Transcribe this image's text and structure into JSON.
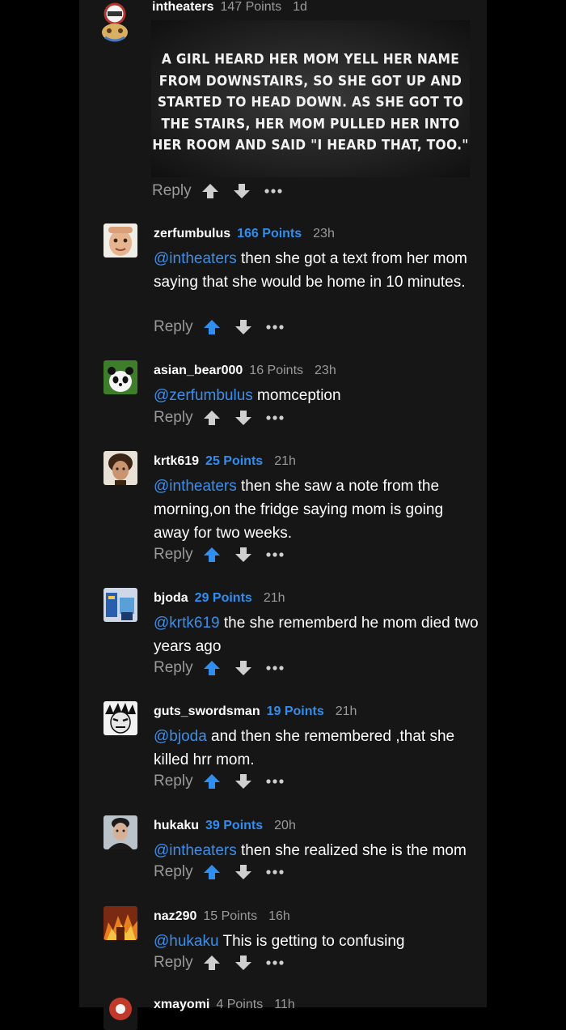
{
  "top_comment": {
    "username": "intheaters",
    "points": "147 Points",
    "time": "1d",
    "meme_text": "A GIRL HEARD HER MOM YELL HER NAME FROM DOWNSTAIRS, SO SHE GOT UP AND STARTED TO HEAD DOWN. AS SHE GOT TO THE STAIRS, HER MOM PULLED HER INTO HER ROOM AND SAID \"I HEARD THAT, TOO.\"",
    "reply_label": "Reply"
  },
  "comments": [
    {
      "username": "zerfumbulus",
      "points": "166 Points",
      "time": "23h",
      "mention": "@intheaters",
      "text": " then she got a text from her mom saying that she would be home in 10 minutes.",
      "reply_label": "Reply",
      "upvoted": true
    },
    {
      "username": "asian_bear000",
      "points": "16 Points",
      "time": "23h",
      "mention": "@zerfumbulus",
      "text": " momception",
      "reply_label": "Reply",
      "upvoted": false
    },
    {
      "username": "krtk619",
      "points": "25 Points",
      "time": "21h",
      "mention": "@intheaters",
      "text": " then she saw a note from the morning,on the fridge saying mom is going away for two weeks.",
      "reply_label": "Reply",
      "upvoted": true
    },
    {
      "username": "bjoda",
      "points": "29 Points",
      "time": "21h",
      "mention": "@krtk619",
      "text": " the she rememberd he mom died two years ago",
      "reply_label": "Reply",
      "upvoted": true
    },
    {
      "username": "guts_swordsman",
      "points": "19 Points",
      "time": "21h",
      "mention": "@bjoda",
      "text": " and then she remembered ,that she killed hrr mom.",
      "reply_label": "Reply",
      "upvoted": true
    },
    {
      "username": "hukaku",
      "points": "39 Points",
      "time": "20h",
      "mention": "@intheaters",
      "text": " then she realized she is the mom",
      "reply_label": "Reply",
      "upvoted": true
    },
    {
      "username": "naz290",
      "points": "15 Points",
      "time": "16h",
      "mention": "@hukaku",
      "text": " This is getting to confusing",
      "reply_label": "Reply",
      "upvoted": false
    },
    {
      "username": "xmayomi",
      "points": "4 Points",
      "time": "11h"
    }
  ],
  "colors": {
    "background": "#000000",
    "panel": "#161616",
    "mention": "#3d8ee8",
    "upvoted": "#2f8ef0",
    "muted": "#9a9a9a"
  },
  "icons": [
    "upvote-arrow-icon",
    "downvote-arrow-icon",
    "more-options-icon"
  ]
}
